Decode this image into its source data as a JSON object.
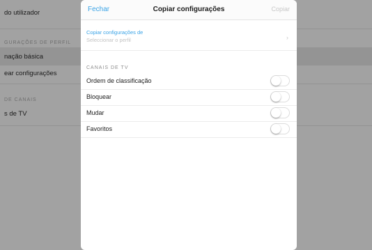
{
  "background": {
    "row_1": "do utilizador",
    "section_1": "GURAÇÕES DE PERFIL",
    "row_2": "nação básica",
    "row_3": "ear configurações",
    "section_2": "DE CANAIS",
    "row_4": "s de TV"
  },
  "modal": {
    "close_label": "Fechar",
    "title": "Copiar configurações",
    "copy_label": "Copiar",
    "copy_settings": {
      "label": "Copiar configurações de",
      "placeholder": "Seleccionar o perfil"
    },
    "section_header": "CANAIS DE TV",
    "toggles": [
      {
        "label": "Ordem de classificação",
        "on": false
      },
      {
        "label": "Bloquear",
        "on": false
      },
      {
        "label": "Mudar",
        "on": false
      },
      {
        "label": "Favoritos",
        "on": false
      }
    ]
  },
  "colors": {
    "accent": "#3aa3e6",
    "disabled": "#c7c7c7"
  }
}
